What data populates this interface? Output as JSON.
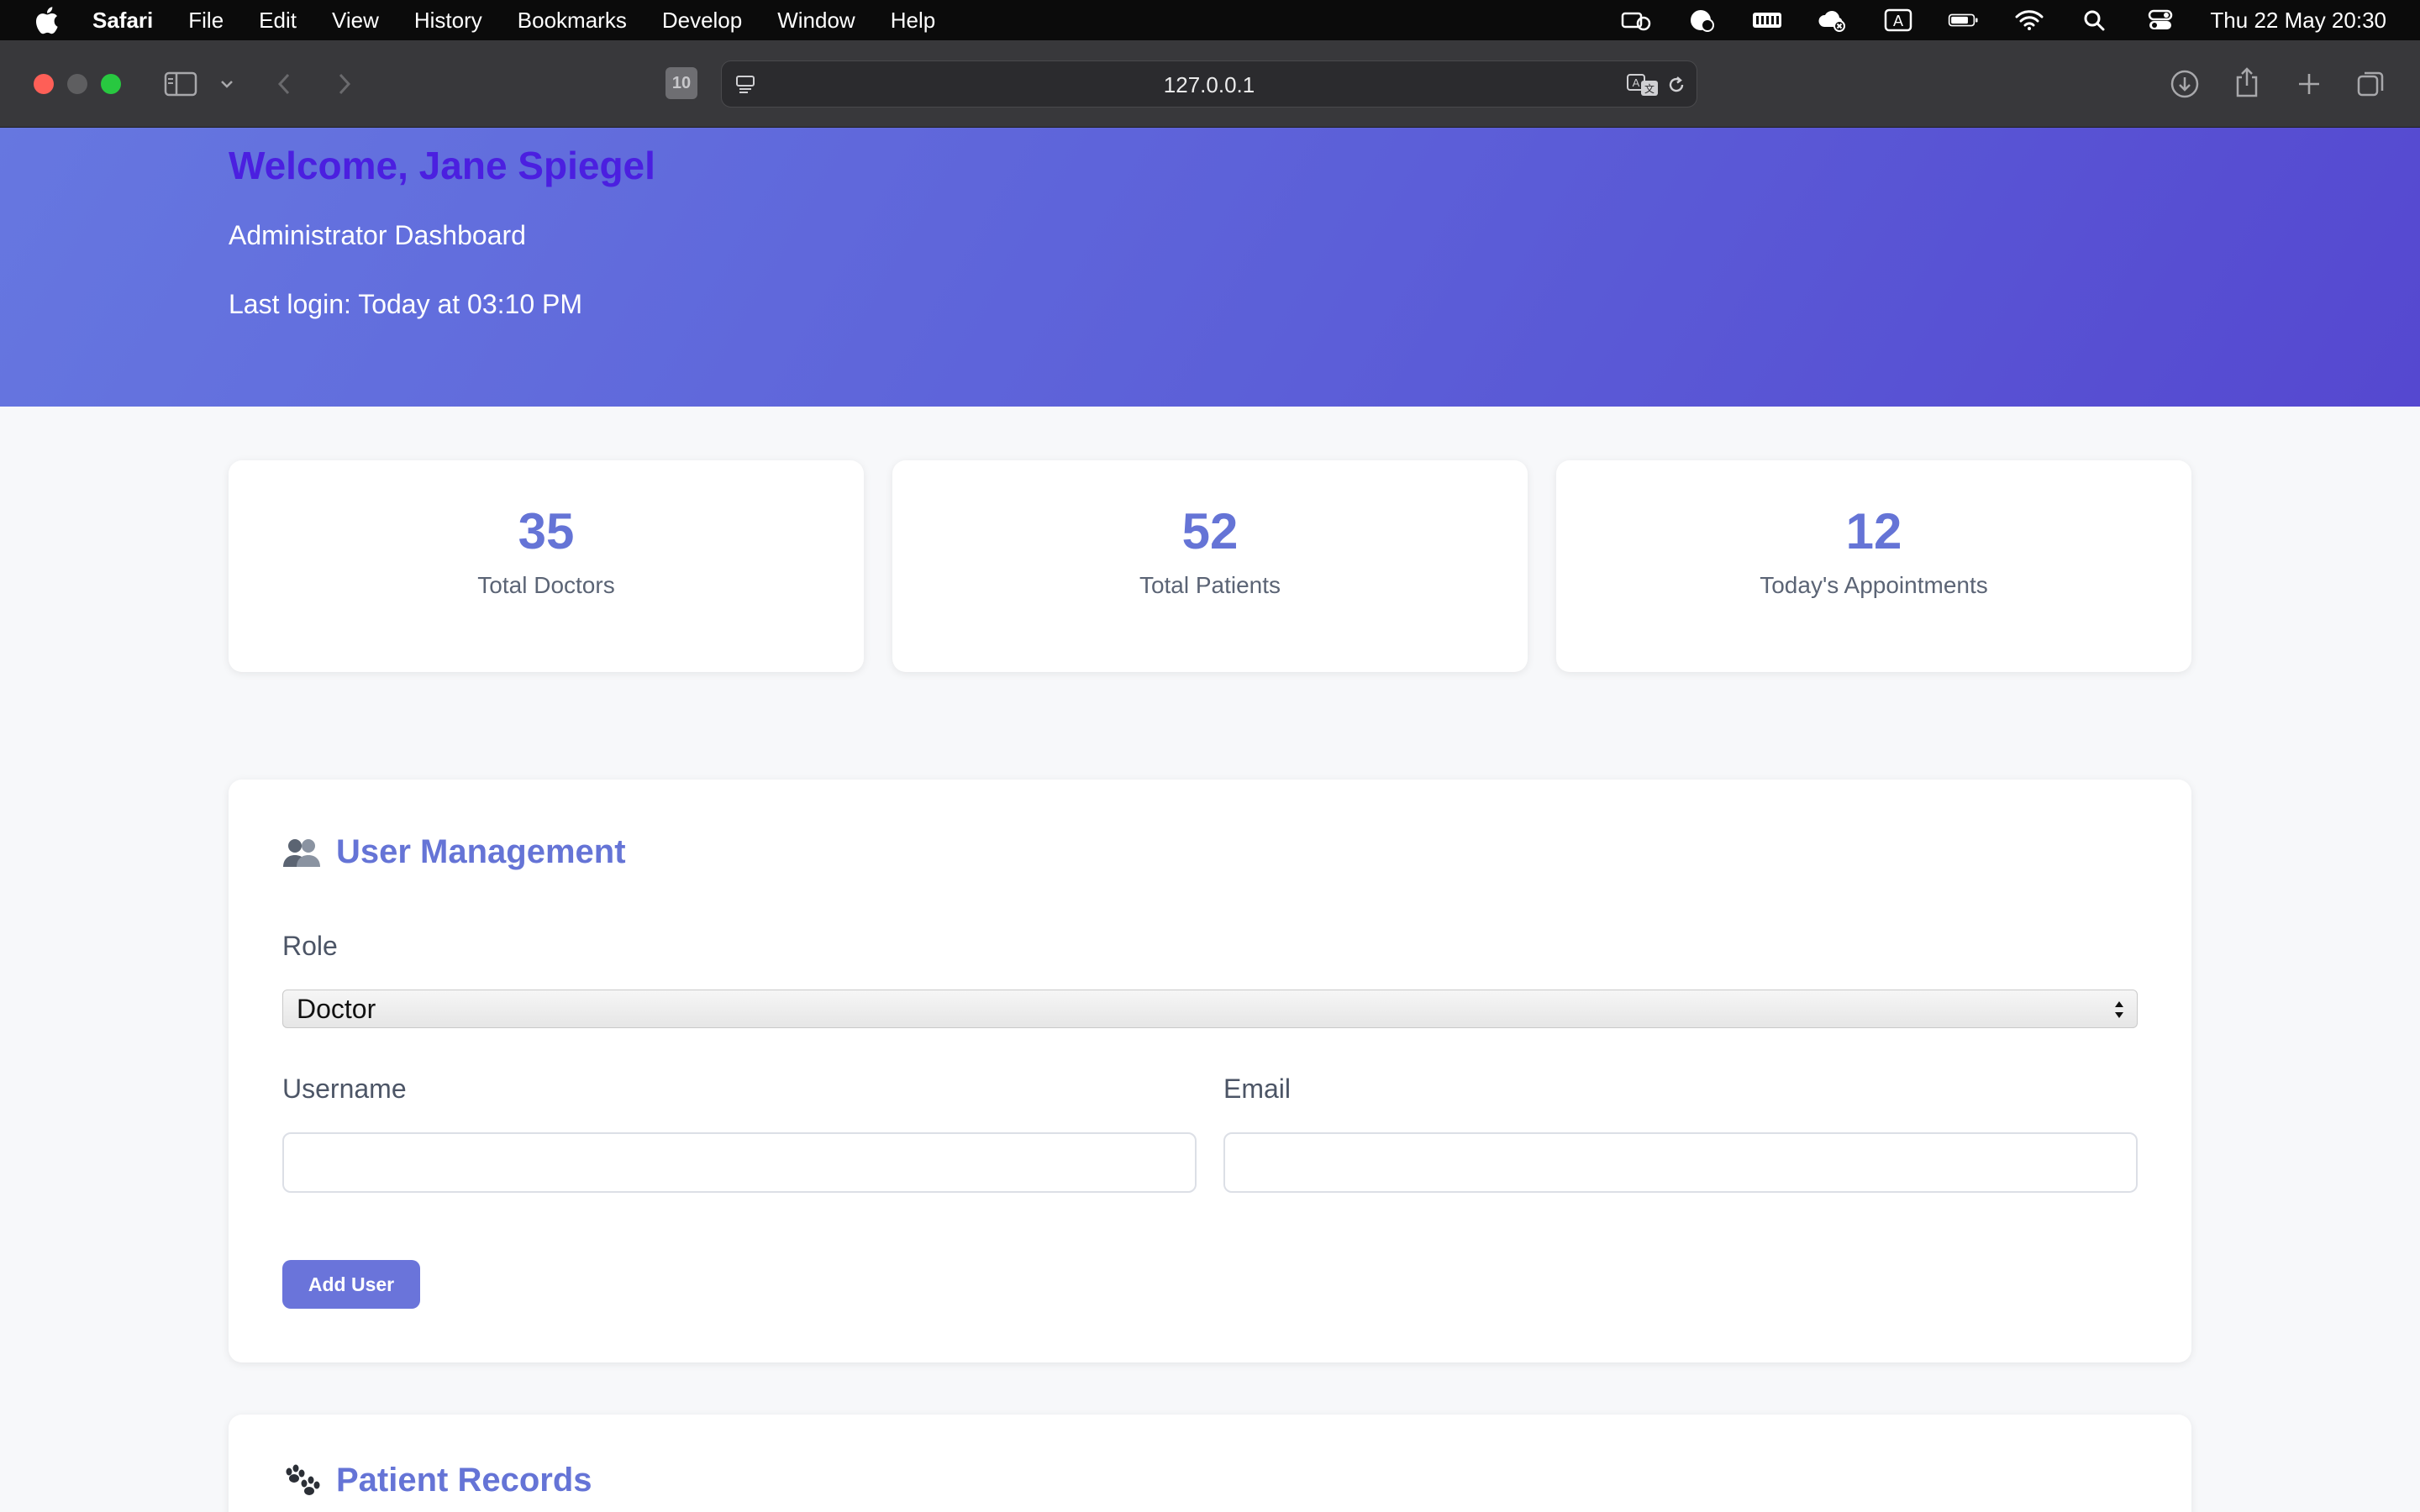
{
  "menubar": {
    "app_name": "Safari",
    "menus": [
      "File",
      "Edit",
      "View",
      "History",
      "Bookmarks",
      "Develop",
      "Window",
      "Help"
    ],
    "clock": "Thu 22 May  20:30",
    "keyboard_indicator": "A"
  },
  "toolbar": {
    "url": "127.0.0.1",
    "tab_badge": "10"
  },
  "header": {
    "welcome": "Welcome, Jane Spiegel",
    "subtitle": "Administrator Dashboard",
    "last_login": "Last login: Today at 03:10 PM"
  },
  "stats": [
    {
      "value": "35",
      "label": "Total Doctors"
    },
    {
      "value": "52",
      "label": "Total Patients"
    },
    {
      "value": "12",
      "label": "Today's Appointments"
    }
  ],
  "user_management": {
    "title": "User Management",
    "icon": "users-icon",
    "role_label": "Role",
    "role_selected": "Doctor",
    "username_label": "Username",
    "username_value": "",
    "email_label": "Email",
    "email_value": "",
    "add_button": "Add User"
  },
  "patient_records": {
    "title": "Patient Records",
    "icon": "paw-prints-icon"
  },
  "colors": {
    "accent": "#6574d6",
    "welcome": "#4b1fe0",
    "hero_start": "#6677e0",
    "hero_end": "#5548d0",
    "button": "#6a74da"
  }
}
